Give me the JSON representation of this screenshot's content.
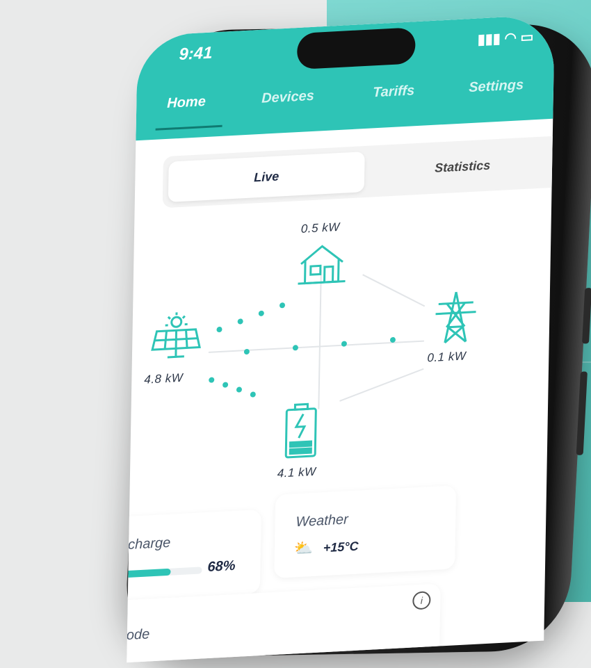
{
  "status_bar": {
    "time": "9:41"
  },
  "nav": {
    "tabs": [
      {
        "label": "Home",
        "active": true
      },
      {
        "label": "Devices",
        "active": false
      },
      {
        "label": "Tariffs",
        "active": false
      },
      {
        "label": "Settings",
        "active": false
      }
    ]
  },
  "segment": {
    "live_label": "Live",
    "statistics_label": "Statistics",
    "selected": "Live"
  },
  "energy_flow": {
    "home": {
      "value": "0.5 kW",
      "icon": "house-icon"
    },
    "solar": {
      "value": "4.8 kW",
      "icon": "solar-panel-icon"
    },
    "grid": {
      "value": "0.1 kW",
      "icon": "power-tower-icon"
    },
    "battery": {
      "value": "4.1 kW",
      "icon": "battery-charging-icon"
    }
  },
  "battery_card": {
    "title": "Battery charge",
    "percent_label": "68%",
    "level": 0.68
  },
  "weather_card": {
    "title": "Weather",
    "temperature": "+15°C",
    "icon": "partly-cloudy-icon"
  },
  "work_mode": {
    "title": "Work mode"
  },
  "colors": {
    "accent": "#2ec4b6",
    "text_dark": "#1f2a44"
  }
}
